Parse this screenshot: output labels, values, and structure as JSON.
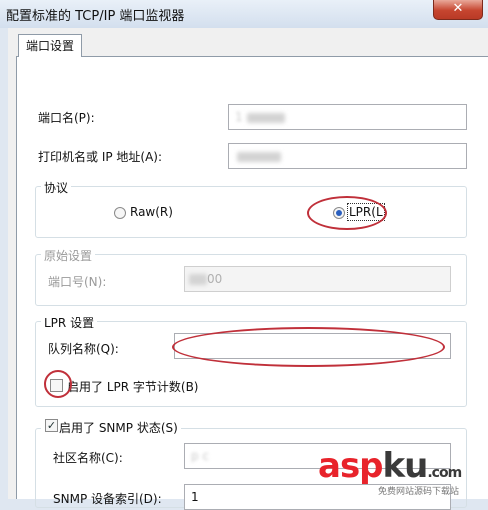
{
  "window": {
    "title": "配置标准的 TCP/IP 端口监视器",
    "close_glyph": "✕"
  },
  "tabs": [
    {
      "label": "端口设置"
    }
  ],
  "port_name": {
    "label": "端口名(P):",
    "value": "1"
  },
  "printer_address": {
    "label": "打印机名或 IP 地址(A):",
    "value": ""
  },
  "protocol": {
    "title": "协议",
    "raw_label": "Raw(R)",
    "lpr_label": "LPR(L)",
    "selected": "LPR"
  },
  "raw_settings": {
    "title": "原始设置",
    "port_number_label": "端口号(N):",
    "port_number_value": "00"
  },
  "lpr_settings": {
    "title": "LPR 设置",
    "queue_label": "队列名称(Q):",
    "queue_value": "",
    "byte_count_label": "启用了 LPR 字节计数(B)",
    "byte_count_checked": false
  },
  "snmp": {
    "enable_label": "启用了 SNMP 状态(S)",
    "enabled": true,
    "community_label": "社区名称(C):",
    "community_value": "p  c",
    "device_index_label": "SNMP 设备索引(D):",
    "device_index_value": "1"
  },
  "watermark": {
    "text_a": "asp",
    "text_b": "ku",
    "text_c": ".com",
    "subtitle": "免费网站源码下载站",
    "color_red": "#e8232b",
    "color_dark": "#3a3a3a"
  },
  "colors": {
    "annotation": "#c0303a",
    "radio_selected": "#2a5fbf"
  }
}
